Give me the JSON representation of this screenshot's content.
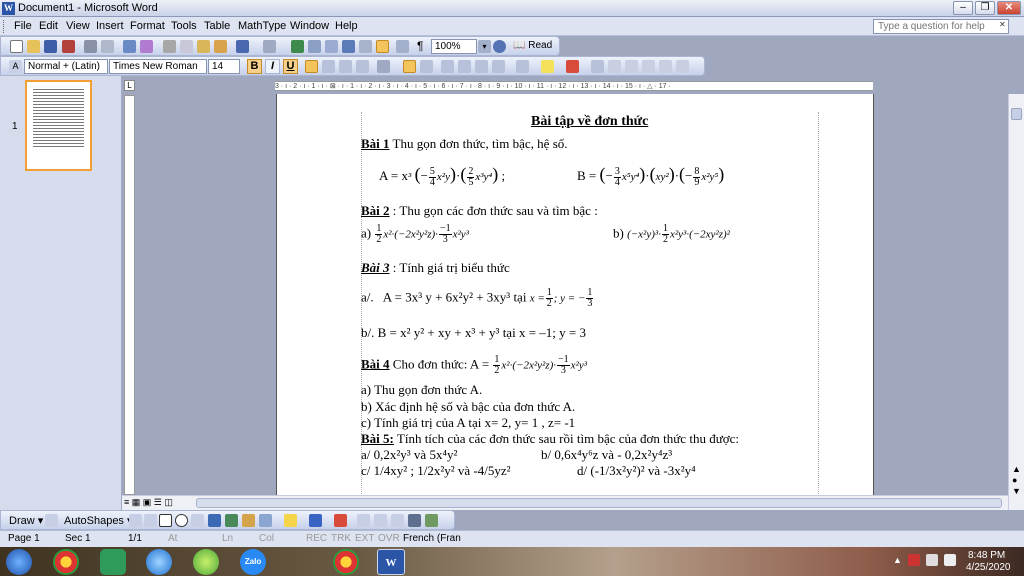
{
  "window": {
    "title": "Document1 - Microsoft Word",
    "app_icon_letter": "W",
    "min_symbol": "–",
    "max_symbol": "❐",
    "close_symbol": "✕"
  },
  "menu": {
    "items": [
      "File",
      "Edit",
      "View",
      "Insert",
      "Format",
      "Tools",
      "Table",
      "MathType",
      "Window",
      "Help"
    ],
    "help_placeholder": "Type a question for help"
  },
  "toolbar": {
    "zoom": "100%",
    "read_label": "Read",
    "style": "Normal + (Latin)",
    "font": "Times New Roman",
    "size": "14",
    "bold": "B",
    "italic": "I",
    "underline": "U",
    "pilcrow": "¶"
  },
  "thumbnail": {
    "page_number": "1"
  },
  "ruler": {
    "corner": "L",
    "marks": "3 · ı · 2 · ı · 1 · ı · ⊠ · ı · 1 · ı · 2 · ı · 3 · ı · 4 · ı · 5 · ı · 6 · ı · 7 · ı · 8 · ı · 9 · ı · 10 · ı · 11 · ı · 12 · ı · 13 · ı · 14 · ı · 15 · ı · △ · 17 ·"
  },
  "document": {
    "title": "Bài tập về đơn thức",
    "bai1": {
      "label": "Bài 1",
      "text": " Thu gọn đơn thức, tìm bậc, hệ số.",
      "expr_a_lhs": "A = x",
      "expr_a_rest": "(−5/4 x²y)·(2/5 x³y⁴) ;",
      "expr_b_lhs": "B =",
      "expr_b_rest": "(−3/4 x⁵y⁴)·(xy²)·(−8/9 x²y⁵)"
    },
    "bai2": {
      "label": "Bài 2",
      "text": " : Thu gọn các đơn thức sau và tìm bậc :",
      "part_a_label": "a)",
      "part_a_expr": "x²·(−2x²y²z)·",
      "part_a_tail": "x²y³",
      "part_b_label": "b)",
      "part_b_expr": "(−x²y)³·",
      "part_b_tail": "x²y³·(−2xy²z)²"
    },
    "bai3": {
      "label": "Bài 3",
      "text": " : Tính giá trị biểu thức",
      "part_a_label": "a/.",
      "part_a_expr": "A = 3x³ y + 6x²y² + 3xy³ tại",
      "part_a_vars_x": "x =",
      "part_a_vars_y": "; y = −",
      "part_b": "b/.   B = x² y² + xy + x³ + y³ tại x = –1; y = 3"
    },
    "bai4": {
      "label": "Bài 4",
      "text": "  Cho đơn thức:  A =",
      "expr_mid": "x²·(−2x²y²z)·",
      "expr_tail": "x²y³",
      "items": [
        "a) Thu gọn đơn thức A.",
        "b) Xác định hệ số và bậc của đơn thức A.",
        "c) Tính giá trị của A tại x= 2, y= 1 , z= -1"
      ]
    },
    "bai5": {
      "label": "Bài 5:",
      "text": " Tính tích của các đơn thức sau rồi tìm bậc của đơn thức thu được:",
      "row1_left": "a/ 0,2x²y³ và 5x⁴y²",
      "row1_right": "b/ 0,6x⁴y⁶z  và - 0,2x²y⁴z³",
      "row2_left": "c/ 1/4xy² ; 1/2x²y² và -4/5yz²",
      "row2_right": "d/  (-1/3x²y²)²  và  -3x²y⁴"
    },
    "fracs": {
      "half_num": "1",
      "half_den": "2",
      "neg1_num": "−1",
      "neg1_den": "3",
      "fivefour_num": "5",
      "fivefour_den": "4",
      "twofive_num": "2",
      "twofive_den": "5",
      "threefour_num": "3",
      "threefour_den": "4",
      "eightnine_num": "8",
      "eightnine_den": "9"
    }
  },
  "drawbar": {
    "draw": "Draw ▾",
    "autoshapes": "AutoShapes ▾"
  },
  "status": {
    "page": "Page 1",
    "sec": "Sec 1",
    "pages": "1/1",
    "at": "At",
    "ln": "Ln",
    "col": "Col",
    "rec": "REC",
    "trk": "TRK",
    "ext": "EXT",
    "ovr": "OVR",
    "lang": "French (Fran"
  },
  "taskbar": {
    "time": "8:48 PM",
    "date": "4/25/2020",
    "tray_lang": "▲"
  },
  "colors": {
    "selection": "#f29f36",
    "window_blue": "#2b56a8"
  }
}
